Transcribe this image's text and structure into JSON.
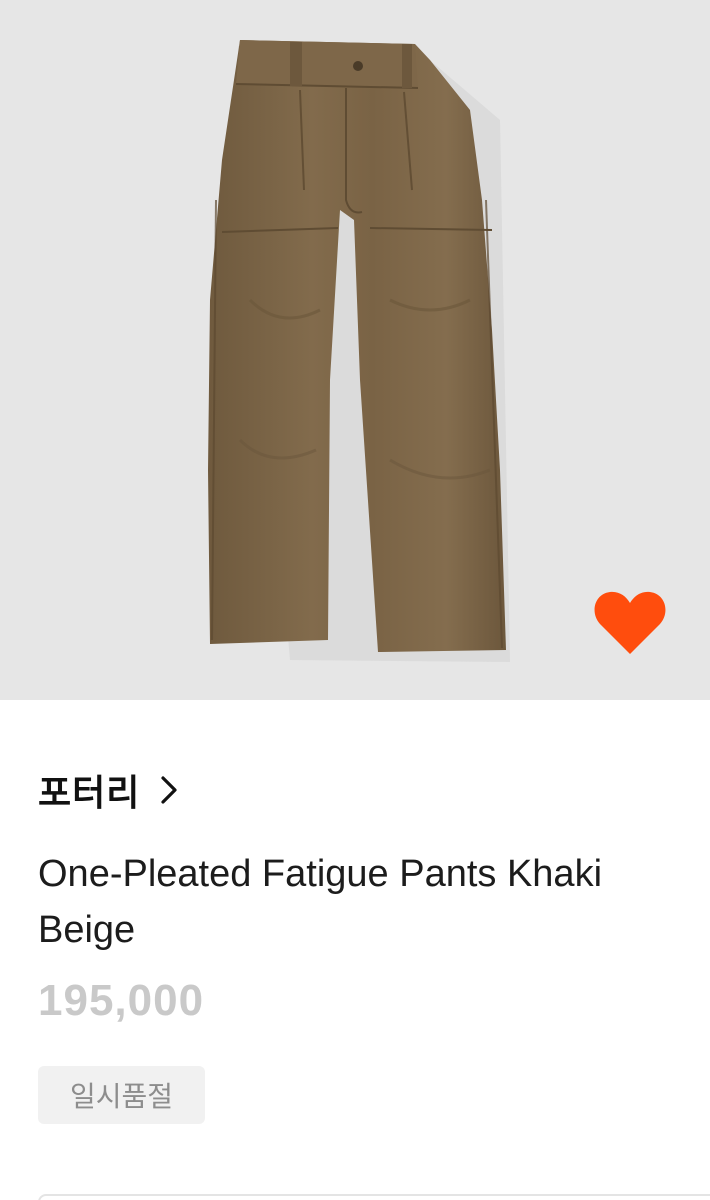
{
  "product": {
    "brand": "포터리",
    "name": "One-Pleated Fatigue Pants Khaki Beige",
    "price": "195,000",
    "status": "일시품절"
  },
  "icons": {
    "wishlist": "heart-icon",
    "brand_link": "chevron-right-icon"
  },
  "colors": {
    "wishlist_heart": "#ff4d0d",
    "image_background": "#e6e6e6",
    "pants": "#7a6446",
    "price_text": "#c9c9c9",
    "status_badge_bg": "#f1f1f1"
  }
}
